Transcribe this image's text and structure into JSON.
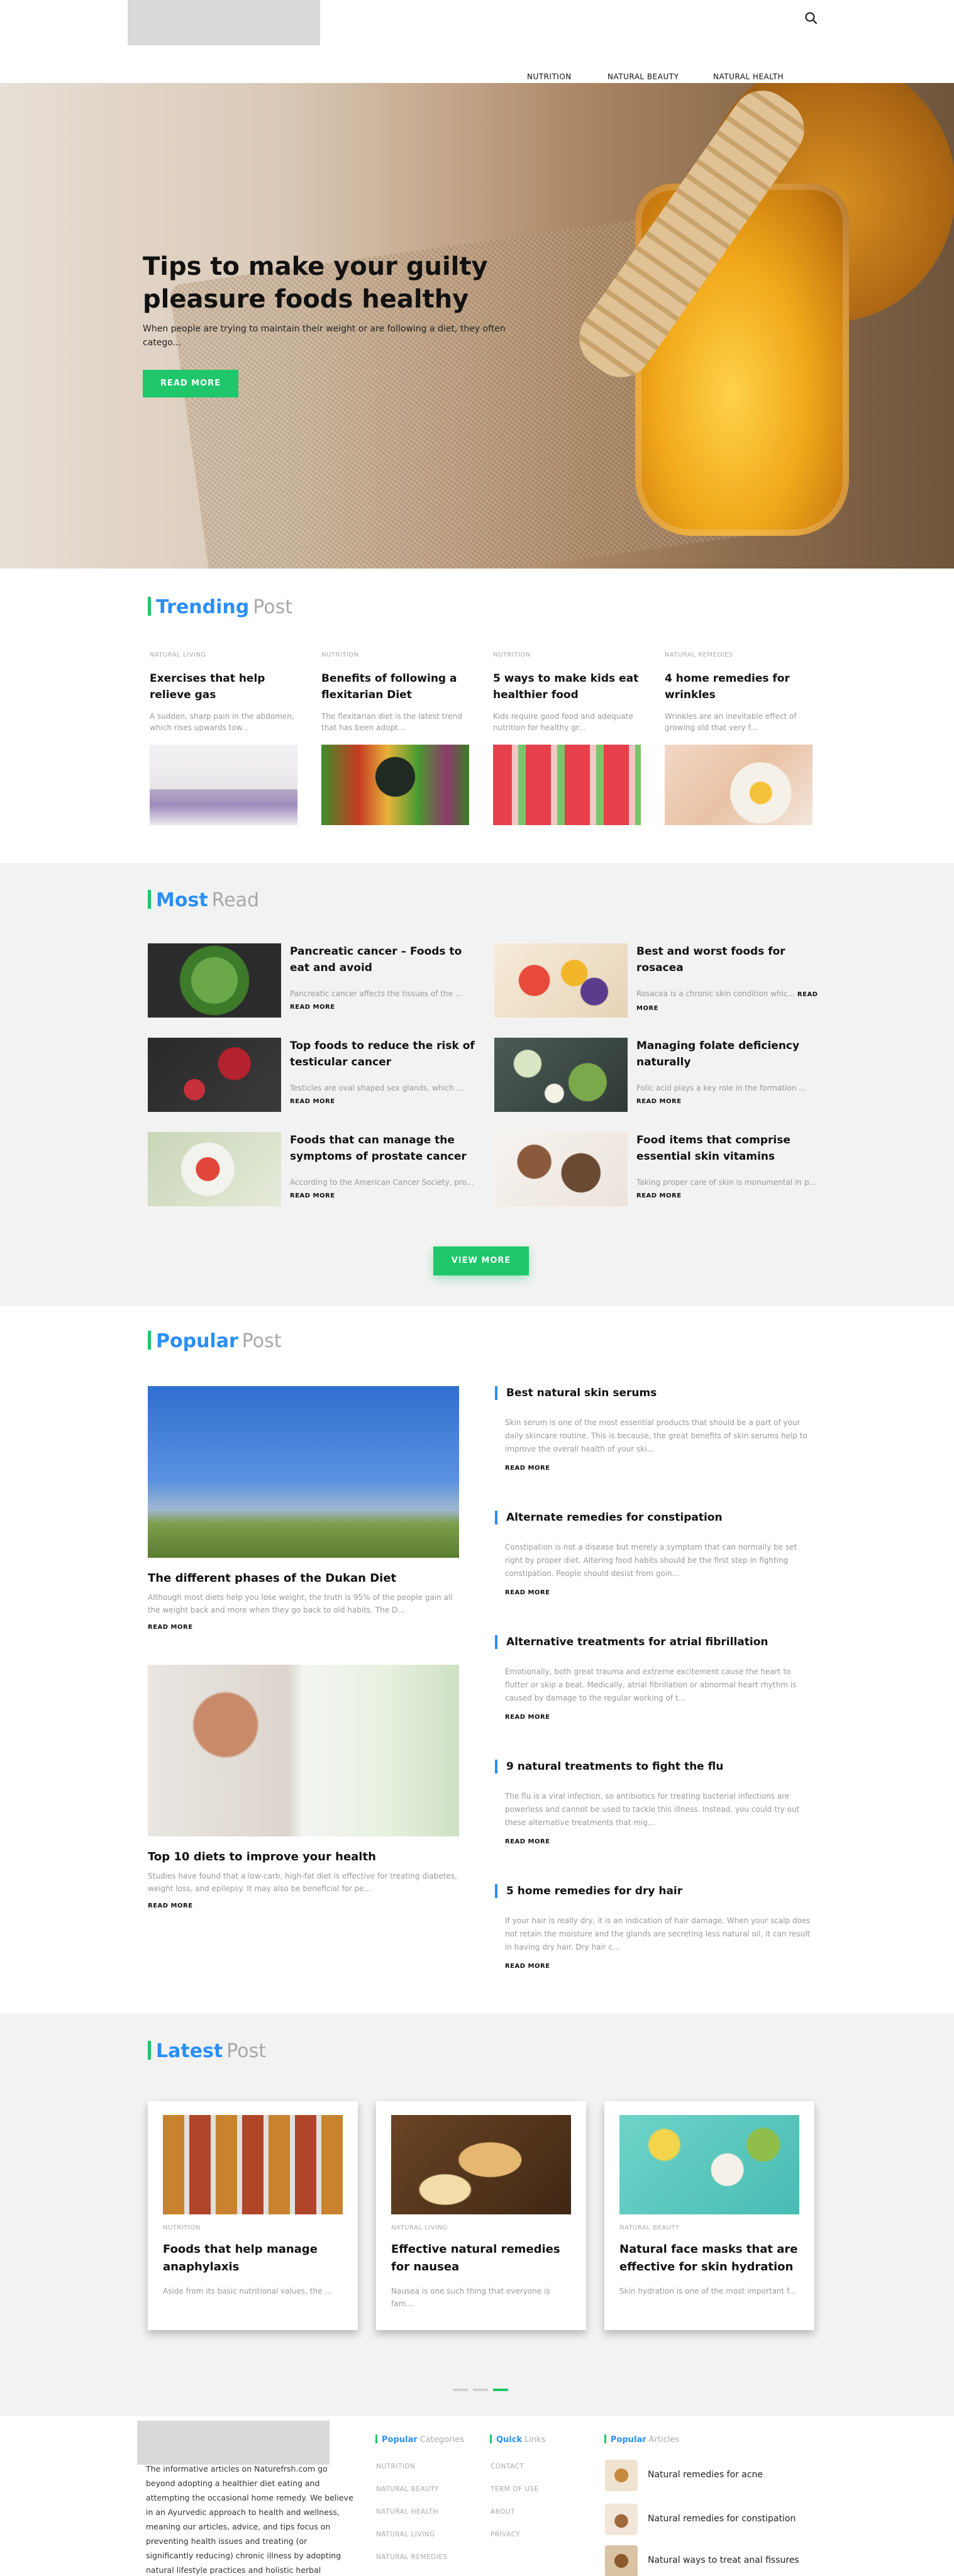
{
  "header": {
    "nav": [
      "NUTRITION",
      "NATURAL BEAUTY",
      "NATURAL HEALTH"
    ]
  },
  "hero": {
    "title": "Tips to make your guilty pleasure foods healthy",
    "subtitle": "When people are trying to maintain their weight or are following a diet, they often catego...",
    "button": "READ MORE"
  },
  "trending": {
    "title_1": "Trending",
    "title_2": "Post",
    "items": [
      {
        "category": "NATURAL LIVING",
        "title": "Exercises that help relieve gas",
        "excerpt": "A sudden, sharp pain in the abdomen, which rises upwards tow..."
      },
      {
        "category": "NUTRITION",
        "title": "Benefits of following a flexitarian Diet",
        "excerpt": "The flexitarian diet is the latest trend that has been adopt..."
      },
      {
        "category": "NUTRITION",
        "title": "5 ways to make kids eat healthier food",
        "excerpt": "Kids require good food and adequate nutrition for healthy gr..."
      },
      {
        "category": "NATURAL REMEDIES",
        "title": "4 home remedies for wrinkles",
        "excerpt": "Wrinkles are an inevitable effect of growing old that very f..."
      }
    ]
  },
  "most_read": {
    "title_1": "Most",
    "title_2": "Read",
    "read_more": "READ MORE",
    "items": [
      {
        "title": "Pancreatic cancer – Foods to eat and avoid",
        "excerpt": "Pancreatic cancer affects the tissues of the ..."
      },
      {
        "title": "Best and worst foods for rosacea",
        "excerpt": "Rosacea is a chronic skin condition whic..."
      },
      {
        "title": "Top foods to reduce the risk of testicular cancer",
        "excerpt": "Testicles are oval shaped sex glands, which ..."
      },
      {
        "title": "Managing folate deficiency naturally",
        "excerpt": "Folic acid plays a key role in the formation ..."
      },
      {
        "title": "Foods that can manage the symptoms of prostate cancer",
        "excerpt": "According to the American Cancer Society, pro..."
      },
      {
        "title": "Food items that comprise essential skin vitamins",
        "excerpt": "Taking proper care of skin is monumental in p..."
      }
    ],
    "view_more": "VIEW MORE"
  },
  "popular": {
    "title_1": "Popular",
    "title_2": "Post",
    "read_more": "READ MORE",
    "featured": [
      {
        "title": "The different phases of the Dukan Diet",
        "excerpt": "Although most diets help you lose weight, the truth is 95% of the people gain all the weight back and more when they go back to old habits. The D..."
      },
      {
        "title": "Top 10 diets to improve your health",
        "excerpt": "Studies have found that a low-carb, high-fat diet is effective for treating diabetes, weight loss, and epilepsy. It may also be beneficial for pe..."
      }
    ],
    "list": [
      {
        "title": "Best natural skin serums",
        "excerpt": "Skin serum is one of the most essential products that should be a part of your daily skincare routine. This is because, the great benefits of skin serums help to improve the overall health of your ski..."
      },
      {
        "title": "Alternate remedies for constipation",
        "excerpt": "Constipation is not a disease but merely a symptom that can normally be set right by proper diet. Altering food habits should be the first step in fighting constipation. People should desist from goin..."
      },
      {
        "title": "Alternative treatments for atrial fibrillation",
        "excerpt": "Emotionally, both great trauma and extreme excitement cause the heart to flutter or skip a beat. Medically, atrial fibrillation or abnormal heart rhythm is caused by damage to the regular working of t..."
      },
      {
        "title": "9 natural treatments to fight the flu",
        "excerpt": "The flu is a viral infection, so antibiotics for treating bacterial infections are powerless and cannot be used to tackle this illness. Instead, you could try out these alternative treatments that mig..."
      },
      {
        "title": "5 home remedies for dry hair",
        "excerpt": "If your hair is really dry, it is an indication of hair damage. When your scalp does not retain the moisture and the glands are secreting less natural oil, it can result in having dry hair. Dry hair c..."
      }
    ]
  },
  "latest": {
    "title_1": "Latest",
    "title_2": "Post",
    "items": [
      {
        "category": "NUTRITION",
        "title": "Foods that help manage anaphylaxis",
        "excerpt": "Aside from its basic nutritional values, the ..."
      },
      {
        "category": "NATURAL LIVING",
        "title": "Effective natural remedies for nausea",
        "excerpt": "Nausea is one such thing that everyone is fam..."
      },
      {
        "category": "NATURAL BEAUTY",
        "title": "Natural face masks that are effective for skin hydration",
        "excerpt": "Skin hydration is one of the most important f..."
      }
    ]
  },
  "footer": {
    "about": "The informative articles on Naturefrsh.com go beyond adopting a healthier diet eating and attempting the occasional home remedy. We believe in an Ayurvedic approach to health and wellness, meaning our articles, advice, and tips focus on preventing health issues and treating (or significantly reducing) chronic illness by adopting natural lifestyle practices and holistic herbal",
    "categories_title_1": "Popular",
    "categories_title_2": "Categories",
    "categories": [
      "NUTRITION",
      "NATURAL BEAUTY",
      "NATURAL HEALTH",
      "NATURAL LIVING",
      "NATURAL REMEDIES"
    ],
    "links_title_1": "Quick",
    "links_title_2": "Links",
    "links": [
      "CONTACT",
      "TERM OF USE",
      "ABOUT",
      "PRIVACY"
    ],
    "articles_title_1": "Popular",
    "articles_title_2": "Articles",
    "articles": [
      "Natural remedies for acne",
      "Natural remedies for constipation",
      "Natural ways to treat anal fissures"
    ]
  }
}
